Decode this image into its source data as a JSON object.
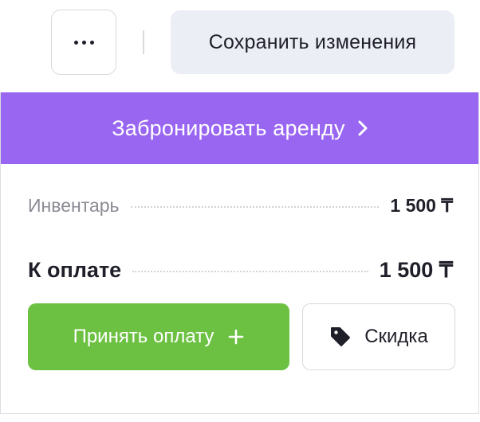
{
  "topbar": {
    "more_icon": "more-horizontal-icon",
    "save_label": "Сохранить изменения"
  },
  "booking": {
    "button_label": "Забронировать аренду",
    "arrow_icon": "chevron-right-icon"
  },
  "summary": {
    "inventory_label": "Инвентарь",
    "inventory_value": "1 500 ₸",
    "total_label": "К оплате",
    "total_value": "1 500 ₸"
  },
  "actions": {
    "accept_label": "Принять оплату",
    "accept_icon": "plus-icon",
    "discount_label": "Скидка",
    "discount_icon": "tag-icon"
  },
  "colors": {
    "accent_purple": "#9966f2",
    "accept_green": "#6cc142",
    "save_bg": "#eceef6"
  }
}
